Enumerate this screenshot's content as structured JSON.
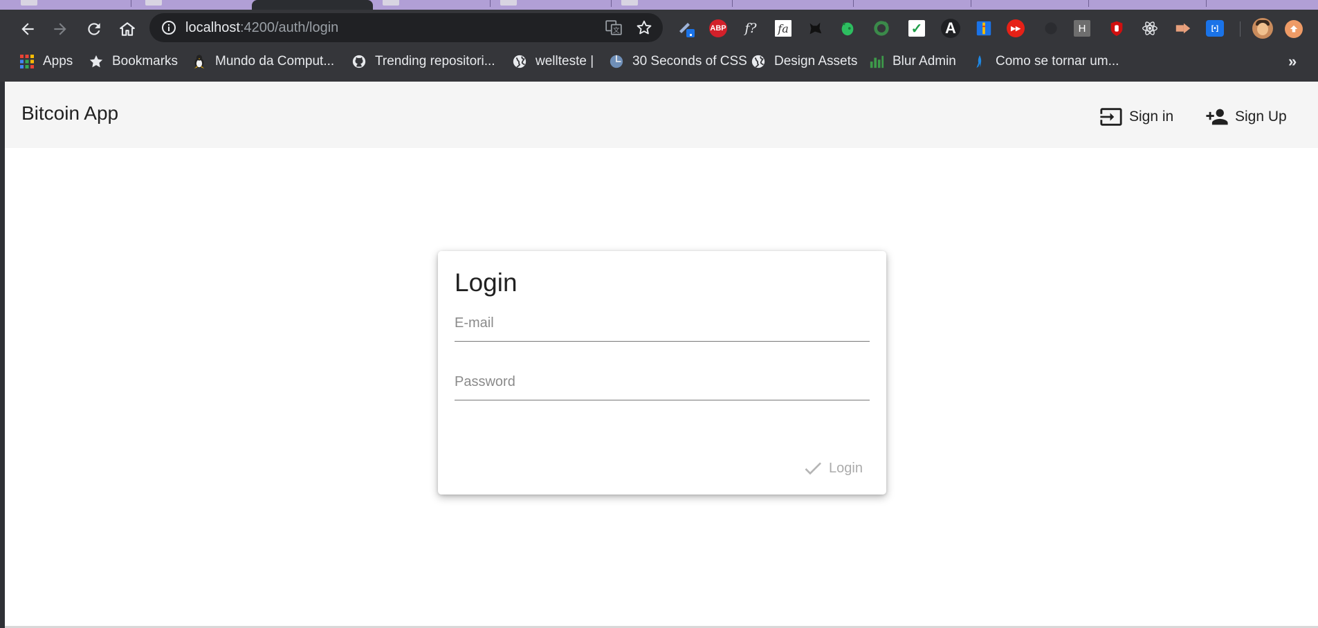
{
  "browser": {
    "url_host": "localhost",
    "url_path": ":4200/auth/login",
    "bookmarks": [
      {
        "label": "Apps",
        "icon": "apps-grid-icon"
      },
      {
        "label": "Bookmarks",
        "icon": "star-icon"
      },
      {
        "label": "Mundo da Comput...",
        "icon": "linux-penguin-icon"
      },
      {
        "label": "Trending repositori...",
        "icon": "github-icon"
      },
      {
        "label": "wellteste |",
        "icon": "globe-icon"
      },
      {
        "label": "30 Seconds of CSS",
        "icon": "globe-icon"
      },
      {
        "label": "Design Assets",
        "icon": "globe-icon"
      },
      {
        "label": "Blur Admin",
        "icon": "chart-icon"
      },
      {
        "label": "Como se tornar um...",
        "icon": "bird-icon"
      }
    ],
    "bookmarks_more": "»",
    "extensions": [
      {
        "name": "pen-extension-icon",
        "text": ""
      },
      {
        "name": "adblock-plus-icon",
        "text": "ABP"
      },
      {
        "name": "whatfont-icon",
        "text": "f?"
      },
      {
        "name": "fontawesome-icon",
        "text": "fa"
      },
      {
        "name": "dark-cat-extension-icon",
        "text": ""
      },
      {
        "name": "evernote-icon",
        "text": ""
      },
      {
        "name": "green-refresh-extension-icon",
        "text": ""
      },
      {
        "name": "checkmark-extension-icon",
        "text": "✓"
      },
      {
        "name": "a-letter-extension-icon",
        "text": "A"
      },
      {
        "name": "blue-ruler-extension-icon",
        "text": ""
      },
      {
        "name": "youtube-extension-icon",
        "text": "▶▶"
      },
      {
        "name": "dark-circle-extension-icon",
        "text": ""
      },
      {
        "name": "h-letter-extension-icon",
        "text": "H"
      },
      {
        "name": "red-hand-extension-icon",
        "text": ""
      },
      {
        "name": "react-devtools-icon",
        "text": ""
      },
      {
        "name": "orange-arrow-extension-icon",
        "text": ""
      },
      {
        "name": "blue-bracket-extension-icon",
        "text": "[•]"
      }
    ],
    "colors": {
      "tabstrip": "#b19fd6",
      "toolbar": "#35363a",
      "omnibox": "#202124"
    }
  },
  "app": {
    "title": "Bitcoin App",
    "nav": {
      "signin_label": "Sign in",
      "signup_label": "Sign Up"
    }
  },
  "login": {
    "title": "Login",
    "email_placeholder": "E-mail",
    "password_placeholder": "Password",
    "submit_label": "Login"
  }
}
